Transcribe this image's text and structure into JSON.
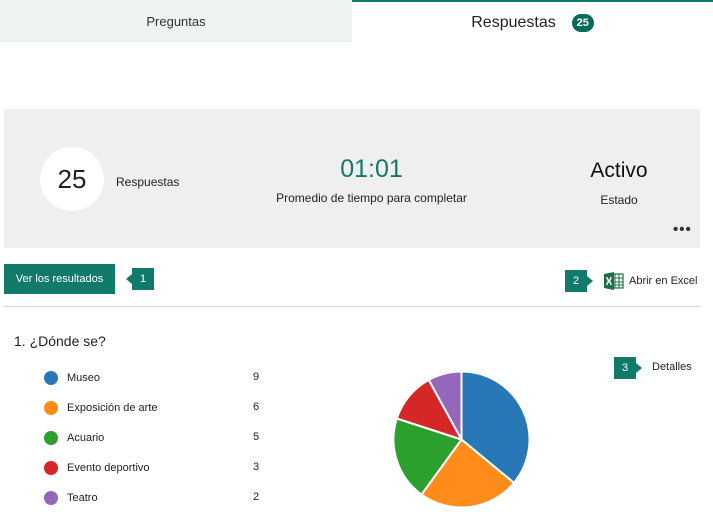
{
  "tabs": {
    "questions_label": "Preguntas",
    "responses_label": "Respuestas",
    "responses_count": "25"
  },
  "summary": {
    "responses_value": "25",
    "responses_label": "Respuestas",
    "avg_time_value": "01:01",
    "avg_time_label": "Promedio de tiempo para completar",
    "status_value": "Activo",
    "status_label": "Estado",
    "more_icon": "ellipsis-icon"
  },
  "actions": {
    "view_results_label": "Ver los resultados",
    "callout_1": "1",
    "callout_2": "2",
    "open_excel_label": "Abrir en Excel",
    "excel_icon": "excel-icon"
  },
  "question": {
    "title": "1.  ¿Dónde se?",
    "callout_3": "3",
    "details_label": "Detalles"
  },
  "chart_data": {
    "type": "pie",
    "categories": [
      "Museo",
      "Exposición de arte",
      "Acuario",
      "Evento deportivo",
      "Teatro"
    ],
    "values": [
      9,
      6,
      5,
      3,
      2
    ],
    "colors": [
      "#2878b8",
      "#ff8c1a",
      "#2ca02c",
      "#d62728",
      "#9467bd"
    ],
    "title": "",
    "legend": "left"
  }
}
